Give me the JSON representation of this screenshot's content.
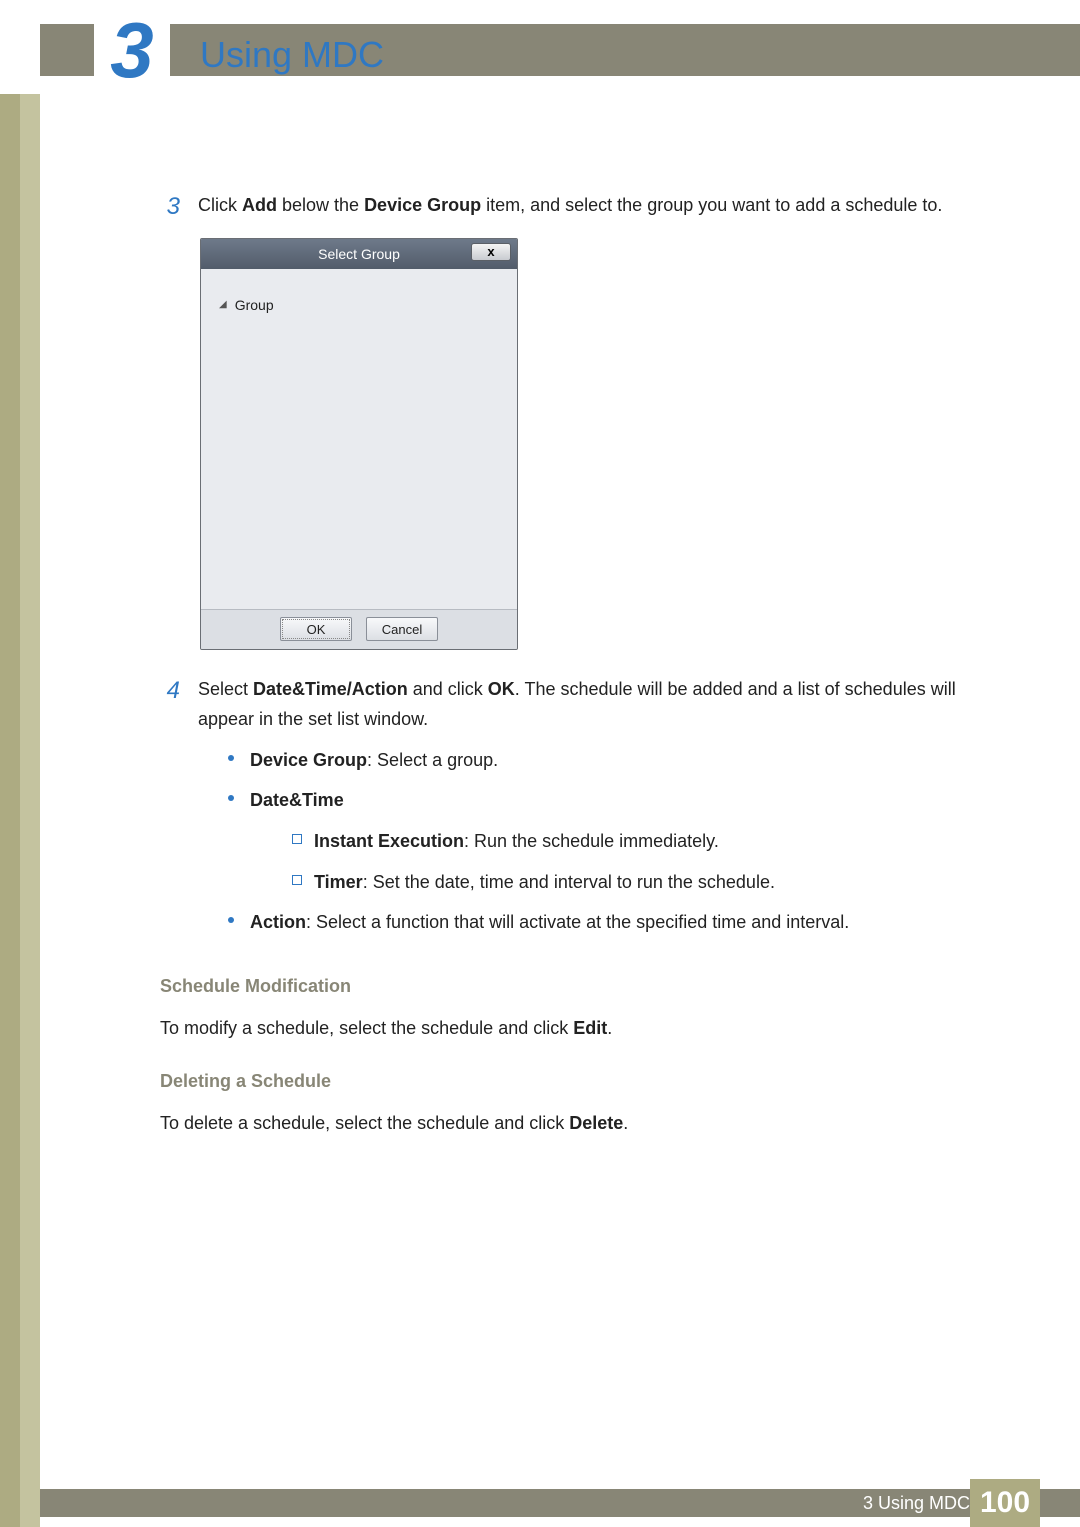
{
  "header": {
    "chapter_number": "3",
    "chapter_title": "Using MDC"
  },
  "steps": {
    "step3": {
      "num": "3",
      "text_pre": "Click ",
      "b1": "Add",
      "text_mid1": " below the ",
      "b2": "Device Group",
      "text_post": " item, and select the group you want to add a schedule to."
    },
    "step4": {
      "num": "4",
      "text_pre": "Select ",
      "b1": "Date&Time/Action",
      "text_mid1": " and click ",
      "b2": "OK",
      "text_post": ". The schedule will be added and a list of schedules will appear in the set list window."
    }
  },
  "dialog": {
    "title": "Select Group",
    "close_label": "x",
    "tree_root": "Group",
    "ok": "OK",
    "cancel": "Cancel"
  },
  "bullets": {
    "device_group_b": "Device Group",
    "device_group_t": ": Select a group.",
    "datetime_b": "Date&Time",
    "instant_b": "Instant Execution",
    "instant_t": ": Run the schedule immediately.",
    "timer_b": "Timer",
    "timer_t": ": Set the date, time and interval to run the schedule.",
    "action_b": "Action",
    "action_t": ": Select a function that will activate at the specified time and interval."
  },
  "sections": {
    "mod_heading": "Schedule Modification",
    "mod_text_pre": "To modify a schedule, select the schedule and click ",
    "mod_text_b": "Edit",
    "mod_text_post": ".",
    "del_heading": "Deleting a Schedule",
    "del_text_pre": "To delete a schedule, select the schedule and click ",
    "del_text_b": "Delete",
    "del_text_post": "."
  },
  "footer": {
    "label": "3 Using MDC",
    "page": "100"
  }
}
